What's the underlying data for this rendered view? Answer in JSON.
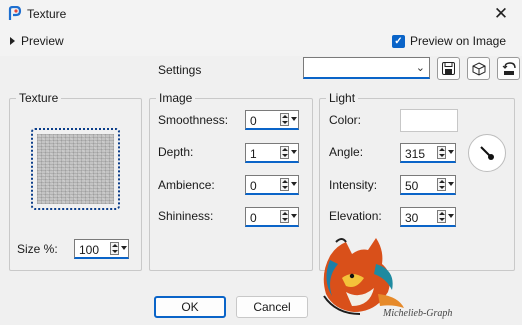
{
  "window": {
    "title": "Texture",
    "app_icon": "paintshop-icon",
    "close_icon": "close-icon"
  },
  "preview": {
    "label": "Preview",
    "on_label": "Preview on Image",
    "on_checked": true
  },
  "settings": {
    "label": "Settings",
    "value": "",
    "buttons": [
      "save-preset-icon",
      "open-cube-icon",
      "reset-icon"
    ]
  },
  "texture": {
    "title": "Texture",
    "size_label": "Size %:",
    "size_value": "100"
  },
  "image": {
    "title": "Image",
    "smoothness_label": "Smoothness:",
    "smoothness": "0",
    "depth_label": "Depth:",
    "depth": "1",
    "ambience_label": "Ambience:",
    "ambience": "0",
    "shininess_label": "Shininess:",
    "shininess": "0"
  },
  "light": {
    "title": "Light",
    "color_label": "Color:",
    "color": "#ffffff",
    "angle_label": "Angle:",
    "angle": "315",
    "intensity_label": "Intensity:",
    "intensity": "50",
    "elevation_label": "Elevation:",
    "elevation": "30"
  },
  "buttons": {
    "ok": "OK",
    "cancel": "Cancel"
  },
  "watermark": "Michelieb-Graph",
  "colors": {
    "accent": "#0a64c8",
    "background": "#f0f0f0"
  }
}
